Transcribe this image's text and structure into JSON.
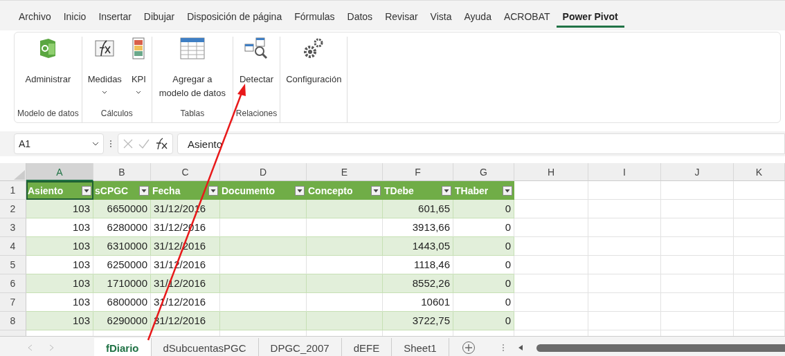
{
  "menu_tabs": [
    {
      "label": "Archivo",
      "selected": false
    },
    {
      "label": "Inicio",
      "selected": false
    },
    {
      "label": "Insertar",
      "selected": false
    },
    {
      "label": "Dibujar",
      "selected": false
    },
    {
      "label": "Disposición de página",
      "selected": false
    },
    {
      "label": "Fórmulas",
      "selected": false
    },
    {
      "label": "Datos",
      "selected": false
    },
    {
      "label": "Revisar",
      "selected": false
    },
    {
      "label": "Vista",
      "selected": false
    },
    {
      "label": "Ayuda",
      "selected": false
    },
    {
      "label": "ACROBAT",
      "selected": false
    },
    {
      "label": "Power Pivot",
      "selected": true
    }
  ],
  "ribbon_groups": [
    {
      "label": "Modelo de datos",
      "buttons": [
        {
          "kind": "manage",
          "label": "Administrar",
          "dropdown": false
        }
      ]
    },
    {
      "label": "Cálculos",
      "buttons": [
        {
          "kind": "measures",
          "label": "Medidas",
          "dropdown": true
        },
        {
          "kind": "kpi",
          "label": "KPI",
          "dropdown": true
        }
      ]
    },
    {
      "label": "Tablas",
      "buttons": [
        {
          "kind": "table",
          "label": "Agregar a modelo de datos",
          "dropdown": false
        }
      ]
    },
    {
      "label": "Relaciones",
      "buttons": [
        {
          "kind": "detect",
          "label": "Detectar",
          "dropdown": false
        }
      ]
    },
    {
      "buttons": [
        {
          "kind": "settings",
          "label": "Configuración",
          "dropdown": false
        }
      ]
    }
  ],
  "formula_bar": {
    "name_box": "A1",
    "formula": "Asiento"
  },
  "columns": [
    {
      "label": "A",
      "selected": true
    },
    {
      "label": "B",
      "selected": false
    },
    {
      "label": "C",
      "selected": false
    },
    {
      "label": "D",
      "selected": false
    },
    {
      "label": "E",
      "selected": false
    },
    {
      "label": "F",
      "selected": false
    },
    {
      "label": "G",
      "selected": false
    },
    {
      "label": "H",
      "selected": false
    },
    {
      "label": "I",
      "selected": false
    },
    {
      "label": "J",
      "selected": false
    },
    {
      "label": "K",
      "selected": false
    }
  ],
  "row_numbers": [
    "1",
    "2",
    "3",
    "4",
    "5",
    "6",
    "7",
    "8"
  ],
  "table": {
    "headers": [
      {
        "label": "Asiento",
        "selected": true
      },
      {
        "label": "sCPGC",
        "selected": false
      },
      {
        "label": "Fecha",
        "selected": false
      },
      {
        "label": "Documento",
        "selected": false
      },
      {
        "label": "Concepto",
        "selected": false
      },
      {
        "label": "TDebe",
        "selected": false
      },
      {
        "label": "THaber",
        "selected": false
      }
    ],
    "rows": [
      [
        "103",
        "6650000",
        "31/12/2016",
        "",
        "",
        "601,65",
        "0"
      ],
      [
        "103",
        "6280000",
        "31/12/2016",
        "",
        "",
        "3913,66",
        "0"
      ],
      [
        "103",
        "6310000",
        "31/12/2016",
        "",
        "",
        "1443,05",
        "0"
      ],
      [
        "103",
        "6250000",
        "31/12/2016",
        "",
        "",
        "1118,46",
        "0"
      ],
      [
        "103",
        "1710000",
        "31/12/2016",
        "",
        "",
        "8552,26",
        "0"
      ],
      [
        "103",
        "6800000",
        "31/12/2016",
        "",
        "",
        "10601",
        "0"
      ],
      [
        "103",
        "6290000",
        "31/12/2016",
        "",
        "",
        "3722,75",
        "0"
      ]
    ]
  },
  "sheet_tabs": [
    {
      "label": "fDiario",
      "selected": true
    },
    {
      "label": "dSubcuentasPGC",
      "selected": false
    },
    {
      "label": "DPGC_2007",
      "selected": false
    },
    {
      "label": "dEFE",
      "selected": false
    },
    {
      "label": "Sheet1",
      "selected": false
    }
  ]
}
